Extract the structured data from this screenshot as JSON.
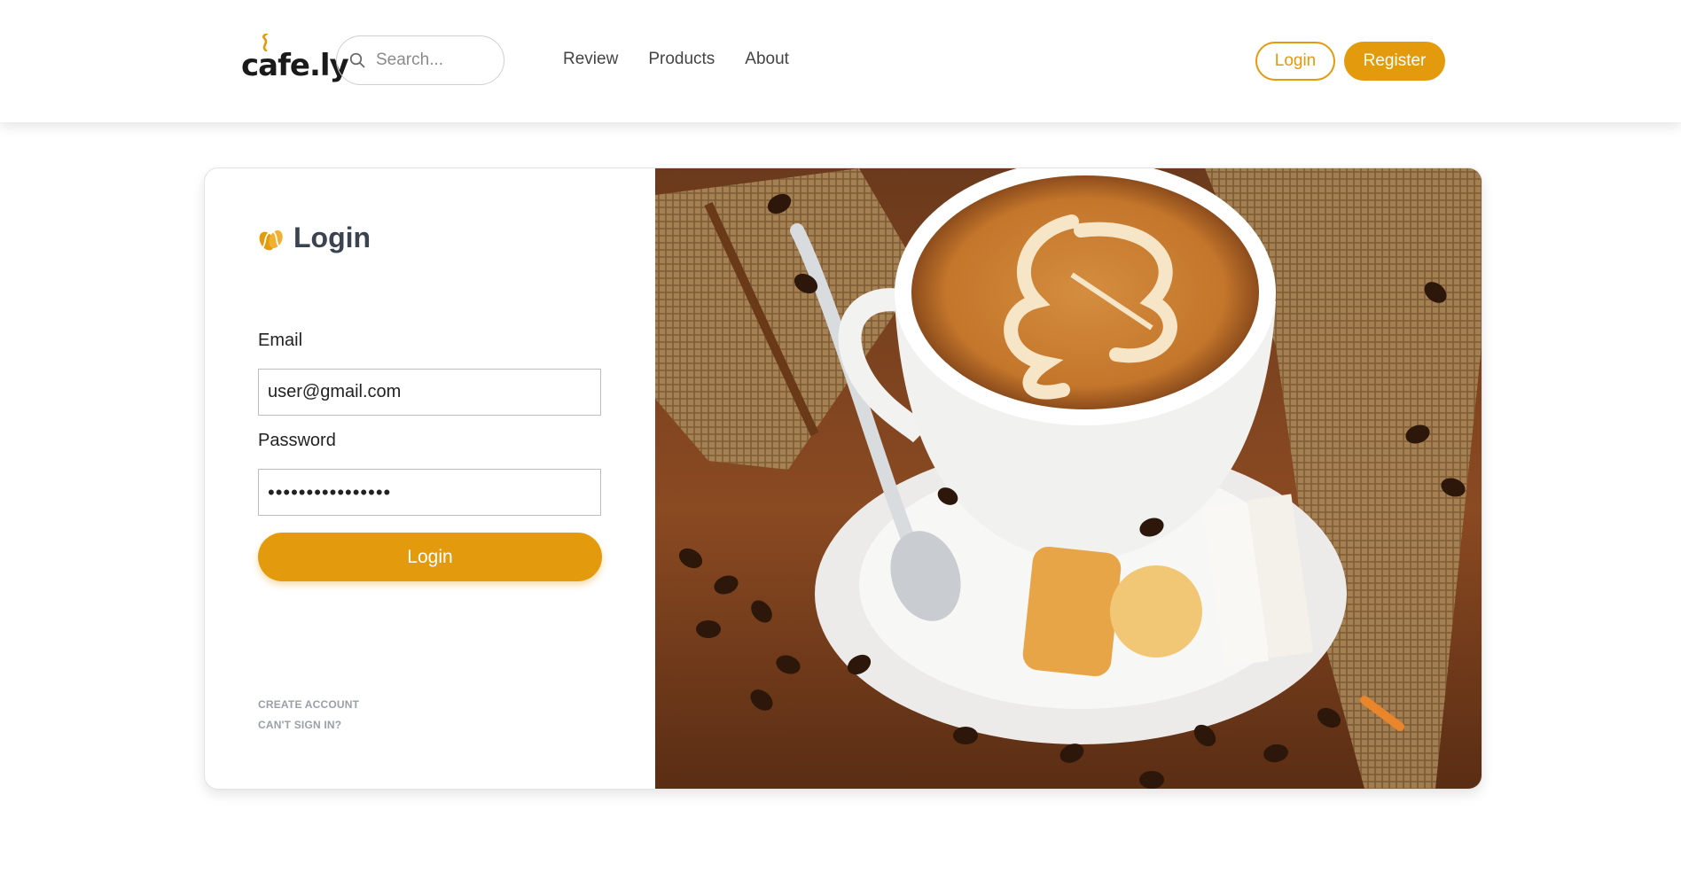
{
  "header": {
    "logo_text": "cafe.ly",
    "search_placeholder": "Search...",
    "nav": [
      "Review",
      "Products",
      "About"
    ],
    "login_label": "Login",
    "register_label": "Register"
  },
  "login_form": {
    "title": "Login",
    "email_label": "Email",
    "email_value": "user@gmail.com",
    "password_label": "Password",
    "password_value": "••••••••••••••••",
    "submit_label": "Login",
    "create_account": "CREATE ACCOUNT",
    "cant_sign_in": "CAN'T SIGN IN?"
  },
  "colors": {
    "accent": "#e39a0c",
    "text_dark": "#3b4250"
  },
  "icons": {
    "search": "search-icon",
    "title": "coffee-beans-icon",
    "logo_steam": "steam-icon"
  }
}
